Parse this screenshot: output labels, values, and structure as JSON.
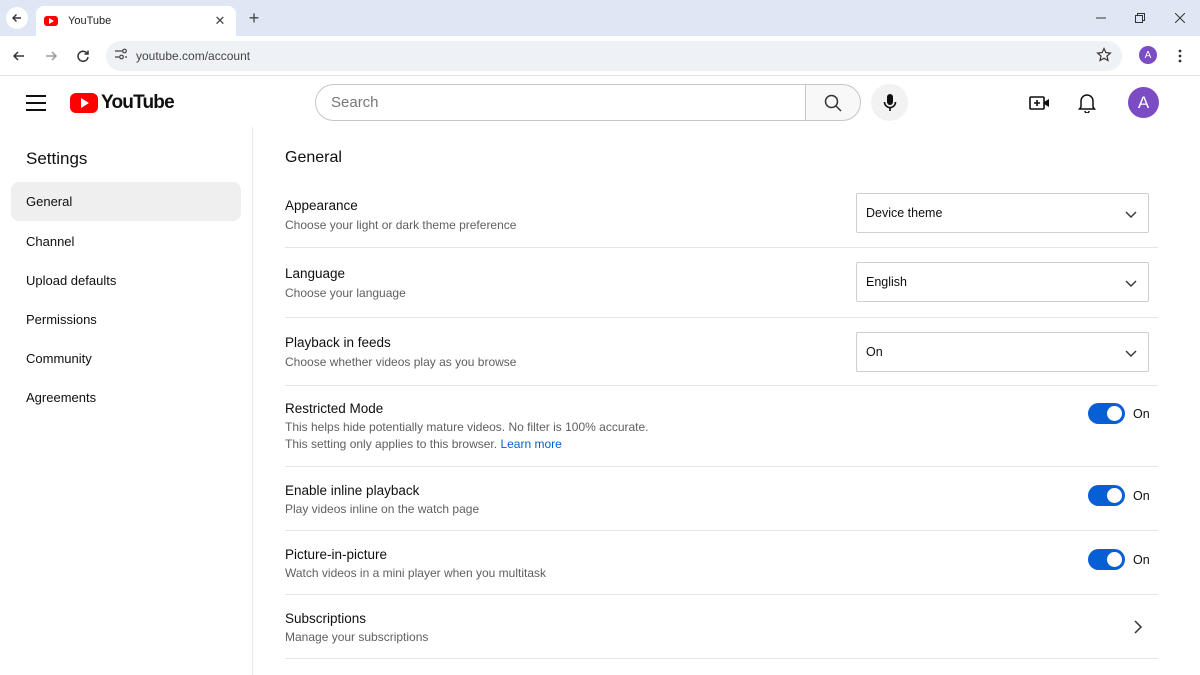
{
  "browser": {
    "tab_title": "YouTube",
    "tab_close": "✕",
    "new_tab": "+",
    "url": "youtube.com/account",
    "profile_initial": "A"
  },
  "masthead": {
    "logo_text": "YouTube",
    "search_placeholder": "Search",
    "avatar_initial": "A"
  },
  "sidebar": {
    "title": "Settings",
    "items": [
      {
        "label": "General",
        "active": true
      },
      {
        "label": "Channel"
      },
      {
        "label": "Upload defaults"
      },
      {
        "label": "Permissions"
      },
      {
        "label": "Community"
      },
      {
        "label": "Agreements"
      }
    ]
  },
  "main": {
    "title": "General",
    "settings": [
      {
        "label": "Appearance",
        "desc": "Choose your light or dark theme preference",
        "control": "dropdown",
        "value": "Device theme"
      },
      {
        "label": "Language",
        "desc": "Choose your language",
        "control": "dropdown",
        "value": "English"
      },
      {
        "label": "Playback in feeds",
        "desc": "Choose whether videos play as you browse",
        "control": "dropdown",
        "value": "On"
      },
      {
        "label": "Restricted Mode",
        "desc": "This helps hide potentially mature videos. No filter is 100% accurate.",
        "desc2": "This setting only applies to this browser.",
        "link": "Learn more",
        "control": "toggle",
        "value": "On"
      },
      {
        "label": "Enable inline playback",
        "desc": "Play videos inline on the watch page",
        "control": "toggle",
        "value": "On"
      },
      {
        "label": "Picture-in-picture",
        "desc": "Watch videos in a mini player when you multitask",
        "control": "toggle",
        "value": "On"
      },
      {
        "label": "Subscriptions",
        "desc": "Manage your subscriptions",
        "control": "chevron"
      }
    ]
  },
  "colors": {
    "accent": "#065fd4",
    "brand_red": "#ff0000",
    "avatar": "#7b4cc4"
  }
}
